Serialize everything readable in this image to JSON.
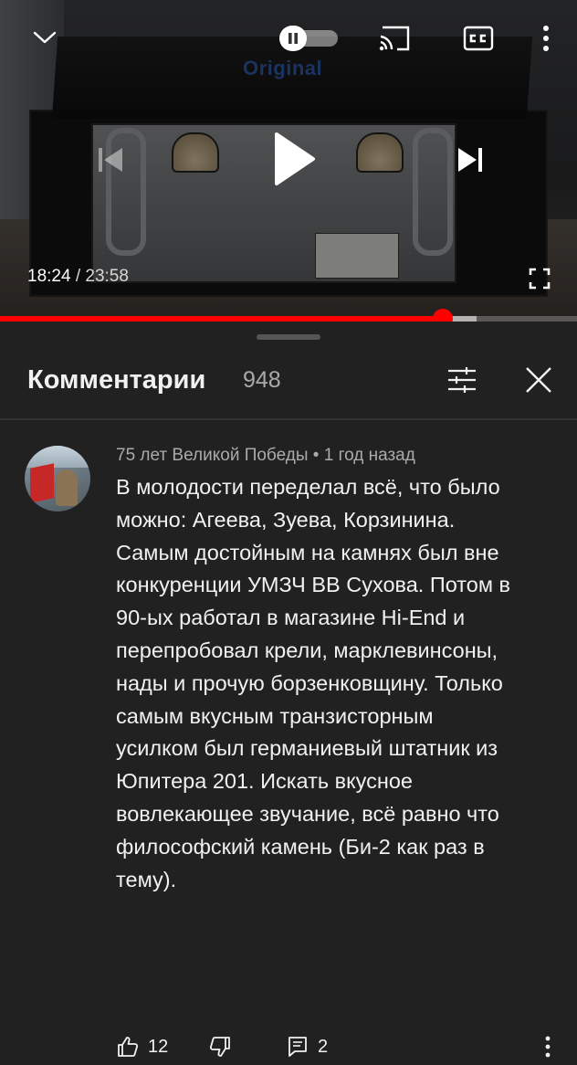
{
  "player": {
    "overlay_brand_text": "Original",
    "current_time": "18:24",
    "time_separator": "/",
    "duration": "23:58",
    "progress_fraction": 0.767,
    "buffer_fraction": 0.826,
    "accent_color": "#ff0000",
    "icons": {
      "collapse": "chevron-down-icon",
      "autoplay": "autoplay-toggle-pause",
      "cast": "cast-icon",
      "captions": "closed-captions-icon",
      "more": "more-vertical-icon",
      "previous": "skip-previous-icon",
      "play": "play-icon",
      "next": "skip-next-icon",
      "fullscreen": "fullscreen-icon"
    }
  },
  "comments_panel": {
    "title": "Комментарии",
    "count": "948",
    "icons": {
      "sort": "sort-filter-icon",
      "close": "close-icon"
    }
  },
  "comment": {
    "author": "75 лет Великой Победы",
    "meta_separator": "•",
    "time_ago": "1 год назад",
    "text": "В молодости переделал всё, что было\nможно: Агеева, Зуева, Корзинина.\nСамым достойным на камнях был вне\nконкуренции УМЗЧ ВВ Сухова. Потом в\n90-ых работал в магазине Hi-End и\nперепробовал крели, марклевинсоны,\nнады и прочую борзенковщину. Только\nсамым вкусным транзисторным\nусилком был германиевый штатник из\nЮпитера 201. Искать вкусное\nвовлекающее звучание, всё равно что\nфилософский камень (Би-2 как раз в\nтему).",
    "likes": "12",
    "replies": "2",
    "icons": {
      "like": "thumbs-up-icon",
      "dislike": "thumbs-down-icon",
      "reply": "reply-comment-icon",
      "more": "more-vertical-icon"
    }
  }
}
